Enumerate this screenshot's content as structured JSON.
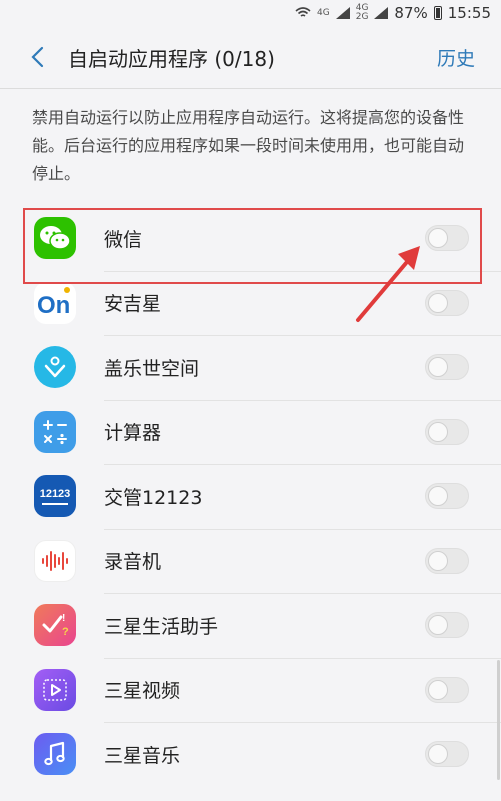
{
  "status_bar": {
    "network_1": "4G",
    "network_2": "4G",
    "network_3": "2G",
    "battery": "87%",
    "time": "15:55"
  },
  "app_bar": {
    "title": "自启动应用程序 (0/18)",
    "action": "历史"
  },
  "description": "禁用自动运行以防止应用程序自动运行。这将提高您的设备性能。后台运行的应用程序如果一段时间未使用用，也可能自动停止。",
  "apps": [
    {
      "name": "微信",
      "icon": "wechat-icon",
      "color": "#2dc100",
      "enabled": false
    },
    {
      "name": "安吉星",
      "icon": "onstar-icon",
      "color": "#ffffff",
      "enabled": false
    },
    {
      "name": "盖乐世空间",
      "icon": "galaxy-space-icon",
      "color": "#26b8e6",
      "enabled": false
    },
    {
      "name": "计算器",
      "icon": "calculator-icon",
      "color": "#3f9de8",
      "enabled": false
    },
    {
      "name": "交管12123",
      "icon": "traffic-12123-icon",
      "color": "#1559b3",
      "icon_text": "12123",
      "enabled": false
    },
    {
      "name": "录音机",
      "icon": "voice-recorder-icon",
      "color": "#ffffff",
      "enabled": false
    },
    {
      "name": "三星生活助手",
      "icon": "samsung-life-assistant-icon",
      "color": "#f06a8c",
      "enabled": false
    },
    {
      "name": "三星视频",
      "icon": "samsung-video-icon",
      "color": "#8a5cf0",
      "enabled": false
    },
    {
      "name": "三星音乐",
      "icon": "samsung-music-icon",
      "color": "#5b6ef0",
      "enabled": false
    }
  ]
}
